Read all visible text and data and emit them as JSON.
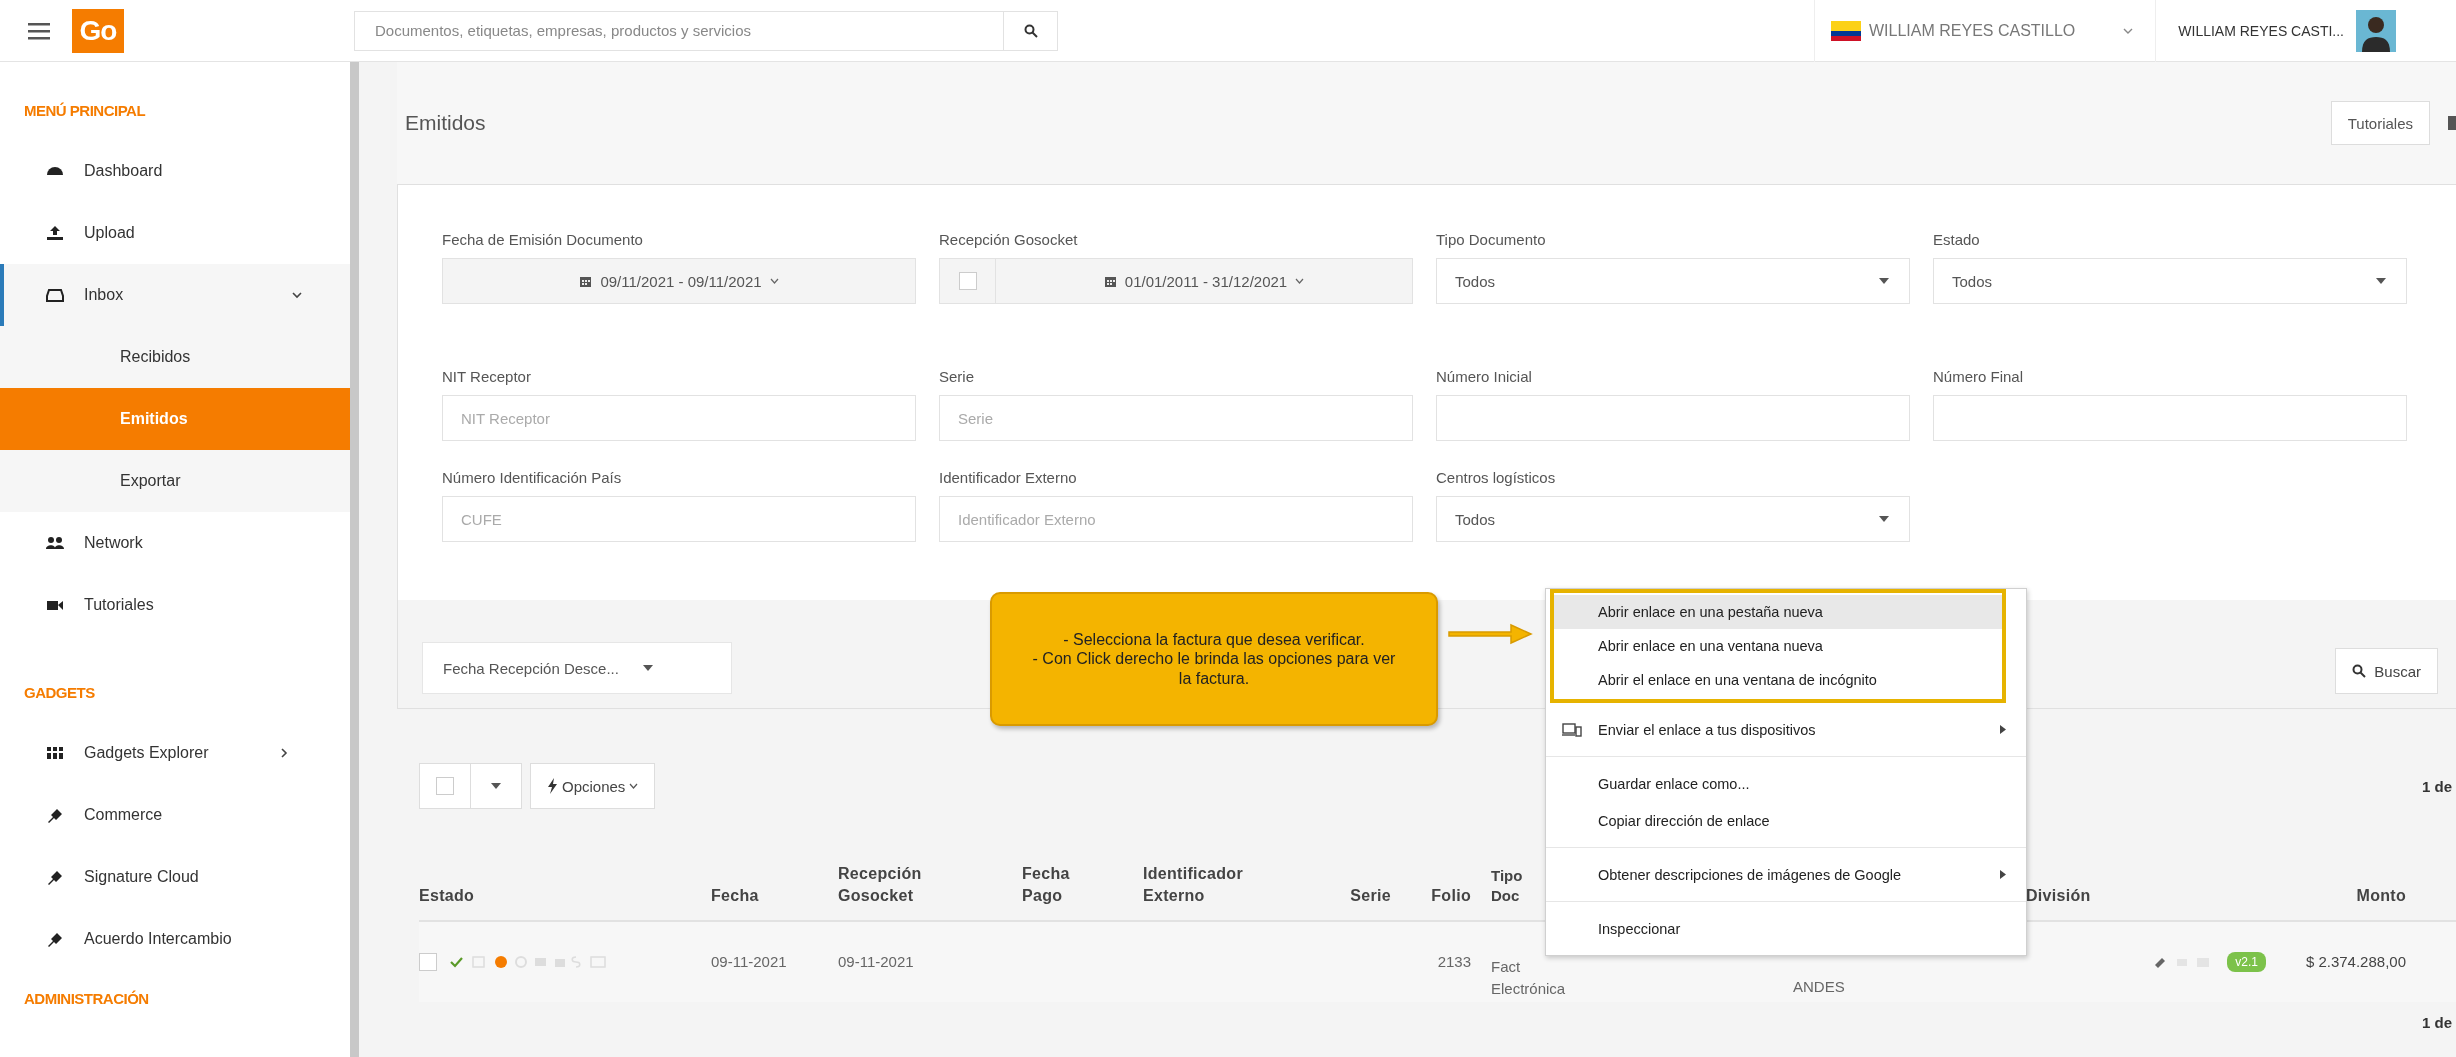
{
  "topbar": {
    "logo": "Go",
    "search": {
      "placeholder": "Documentos, etiquetas, empresas, productos y servicios"
    },
    "company": "WILLIAM REYES CASTILLO",
    "user": "WILLIAM REYES CASTI..."
  },
  "sidebar": {
    "sections": [
      {
        "title": "MENÚ PRINCIPAL",
        "items": [
          {
            "label": "Dashboard",
            "kind": "link",
            "selected": false
          },
          {
            "label": "Upload",
            "kind": "link",
            "selected": false
          },
          {
            "label": "Inbox",
            "kind": "group",
            "expanded": true,
            "selected": false,
            "children": [
              {
                "label": "Recibidos",
                "selected": false
              },
              {
                "label": "Emitidos",
                "selected": true
              },
              {
                "label": "Exportar",
                "selected": false
              }
            ]
          },
          {
            "label": "Network",
            "kind": "link",
            "selected": false
          },
          {
            "label": "Tutoriales",
            "kind": "link",
            "selected": false
          }
        ]
      },
      {
        "title": "GADGETS",
        "items": [
          {
            "label": "Gadgets Explorer",
            "kind": "group",
            "expanded": false,
            "selected": false
          },
          {
            "label": "Commerce",
            "kind": "link",
            "selected": false
          },
          {
            "label": "Signature Cloud",
            "kind": "link",
            "selected": false
          },
          {
            "label": "Acuerdo Intercambio",
            "kind": "link",
            "selected": false
          }
        ]
      },
      {
        "title": "ADMINISTRACIÓN"
      }
    ]
  },
  "page": {
    "title": "Emitidos",
    "tutorials_button": "Tutoriales"
  },
  "filters": [
    {
      "label": "Fecha de Emisión Documento",
      "kind": "daterange",
      "value": "09/11/2021 - 09/11/2021"
    },
    {
      "label": "Recepción Gosocket",
      "kind": "checkdaterange",
      "checked": false,
      "value": "01/01/2011 - 31/12/2021"
    },
    {
      "label": "Tipo Documento",
      "kind": "select",
      "value": "Todos"
    },
    {
      "label": "Estado",
      "kind": "select",
      "value": "Todos"
    },
    {
      "label": "NIT Receptor",
      "kind": "input",
      "placeholder": "NIT Receptor"
    },
    {
      "label": "Serie",
      "kind": "input",
      "placeholder": "Serie"
    },
    {
      "label": "Número Inicial",
      "kind": "input"
    },
    {
      "label": "Número Final",
      "kind": "input"
    },
    {
      "label": "Número Identificación País",
      "kind": "input",
      "placeholder": "CUFE"
    },
    {
      "label": "Identificador Externo",
      "kind": "input",
      "placeholder": "Identificador Externo"
    },
    {
      "label": "Centros logísticos",
      "kind": "select",
      "value": "Todos"
    }
  ],
  "sort": {
    "value": "Fecha Recepción Desce..."
  },
  "search_button": "Buscar",
  "toolbar": {
    "select_all": false,
    "options_button": "Opciones",
    "pagination": "1 de"
  },
  "table": {
    "columns": {
      "estado": "Estado",
      "fecha": "Fecha",
      "recepcion": [
        "Recepción",
        "Gosocket"
      ],
      "fecha_pago": [
        "Fecha",
        "Pago"
      ],
      "identificador": [
        "Identificador",
        "Externo"
      ],
      "serie": "Serie",
      "folio": "Folio",
      "tipo_doc": [
        "Tipo",
        "Doc"
      ],
      "division": "División",
      "monto": "Monto"
    },
    "rows": [
      {
        "selected": false,
        "fecha": "09-11-2021",
        "recepcion": "09-11-2021",
        "folio": "2133",
        "tipo_doc": [
          "Fact",
          "Electrónica"
        ],
        "column_9": "ANDES",
        "version": "v2.1",
        "monto": "$ 2.374.288,00"
      }
    ]
  },
  "pagination_bottom": "1 de",
  "callout": {
    "lines": [
      "- Selecciona la factura que desea verificar.",
      "- Con Click derecho le brinda las opciones para ver la factura."
    ]
  },
  "context_menu": {
    "groups": [
      [
        {
          "label": "Abrir enlace en una pestaña nueva",
          "selected": true,
          "submenu": false
        },
        {
          "label": "Abrir enlace en una ventana nueva",
          "selected": false,
          "submenu": false
        },
        {
          "label": "Abrir el enlace en una ventana de incógnito",
          "selected": false,
          "submenu": false
        }
      ],
      [
        {
          "label": "Enviar el enlace a tus dispositivos",
          "selected": false,
          "submenu": true
        }
      ],
      [
        {
          "label": "Guardar enlace como...",
          "selected": false,
          "submenu": false
        },
        {
          "label": "Copiar dirección de enlace",
          "selected": false,
          "submenu": false
        }
      ],
      [
        {
          "label": "Obtener descripciones de imágenes de Google",
          "selected": false,
          "submenu": true
        }
      ],
      [
        {
          "label": "Inspeccionar",
          "selected": false,
          "submenu": false
        }
      ]
    ]
  }
}
